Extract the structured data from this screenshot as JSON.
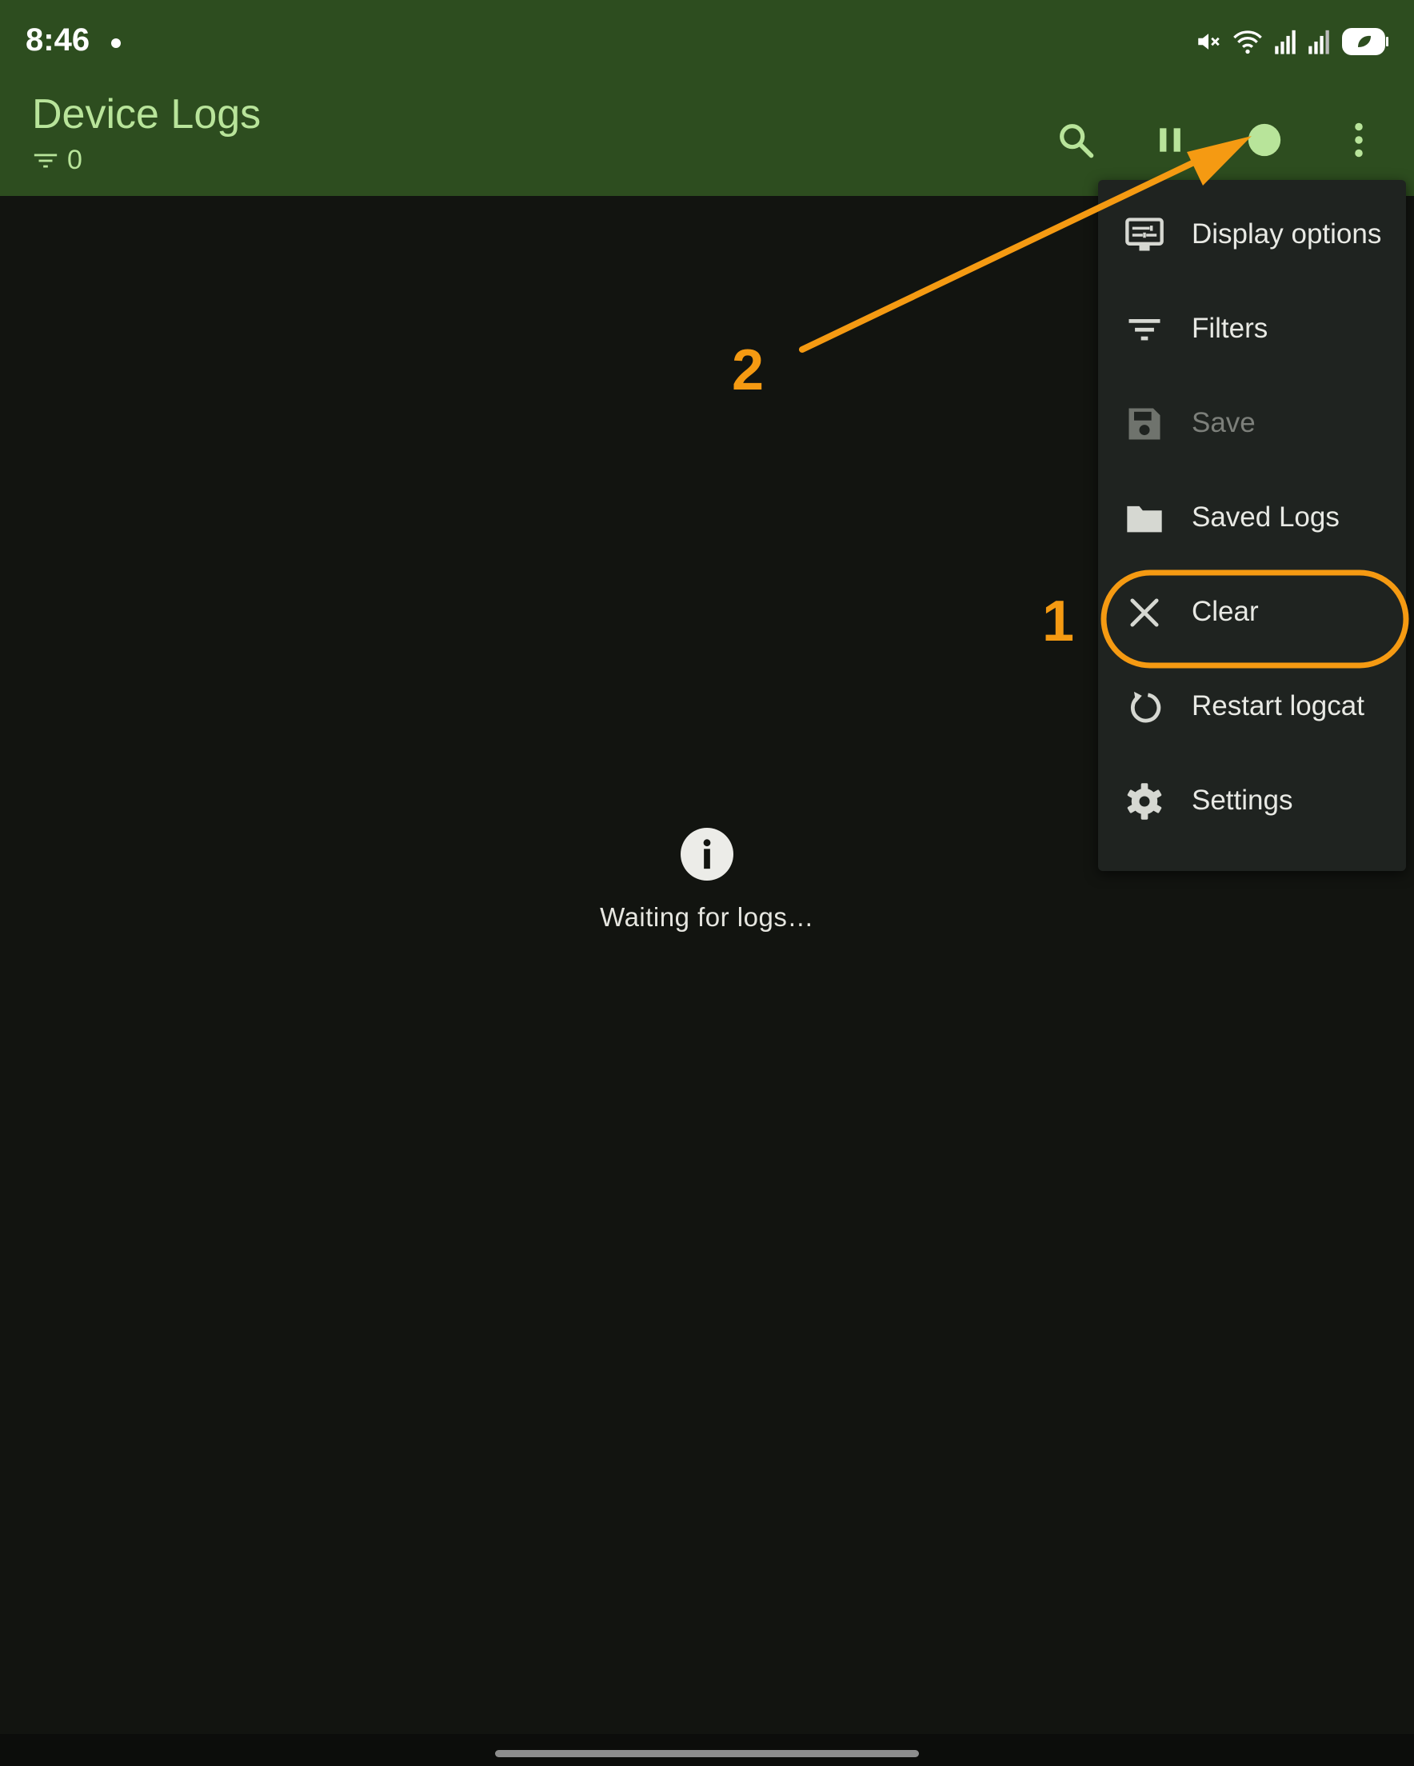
{
  "status_bar": {
    "time": "8:46",
    "icons": [
      "mute-icon",
      "wifi-icon",
      "signal-icon",
      "signal-icon",
      "battery-saver-icon"
    ]
  },
  "app_bar": {
    "title": "Device Logs",
    "filter_count": "0",
    "actions": [
      "search-icon",
      "pause-icon",
      "recording-status-icon",
      "more-vert-icon"
    ]
  },
  "menu": {
    "items": [
      {
        "label": "Display options",
        "icon": "display-options-icon"
      },
      {
        "label": "Filters",
        "icon": "filter-icon"
      },
      {
        "label": "Save",
        "icon": "save-icon",
        "disabled": true
      },
      {
        "label": "Saved Logs",
        "icon": "folder-icon"
      },
      {
        "label": "Clear",
        "icon": "close-icon"
      },
      {
        "label": "Restart logcat",
        "icon": "restart-icon"
      },
      {
        "label": "Settings",
        "icon": "gear-icon"
      }
    ]
  },
  "empty_state": {
    "icon": "info-icon",
    "text": "Waiting for logs…"
  },
  "annotations": {
    "label_1": "1",
    "label_2": "2",
    "color": "#f59a12"
  },
  "colors": {
    "app_bar": "#2d4d1f",
    "accent": "#b8e49a",
    "background": "#121410",
    "menu_background": "#1f2320"
  }
}
